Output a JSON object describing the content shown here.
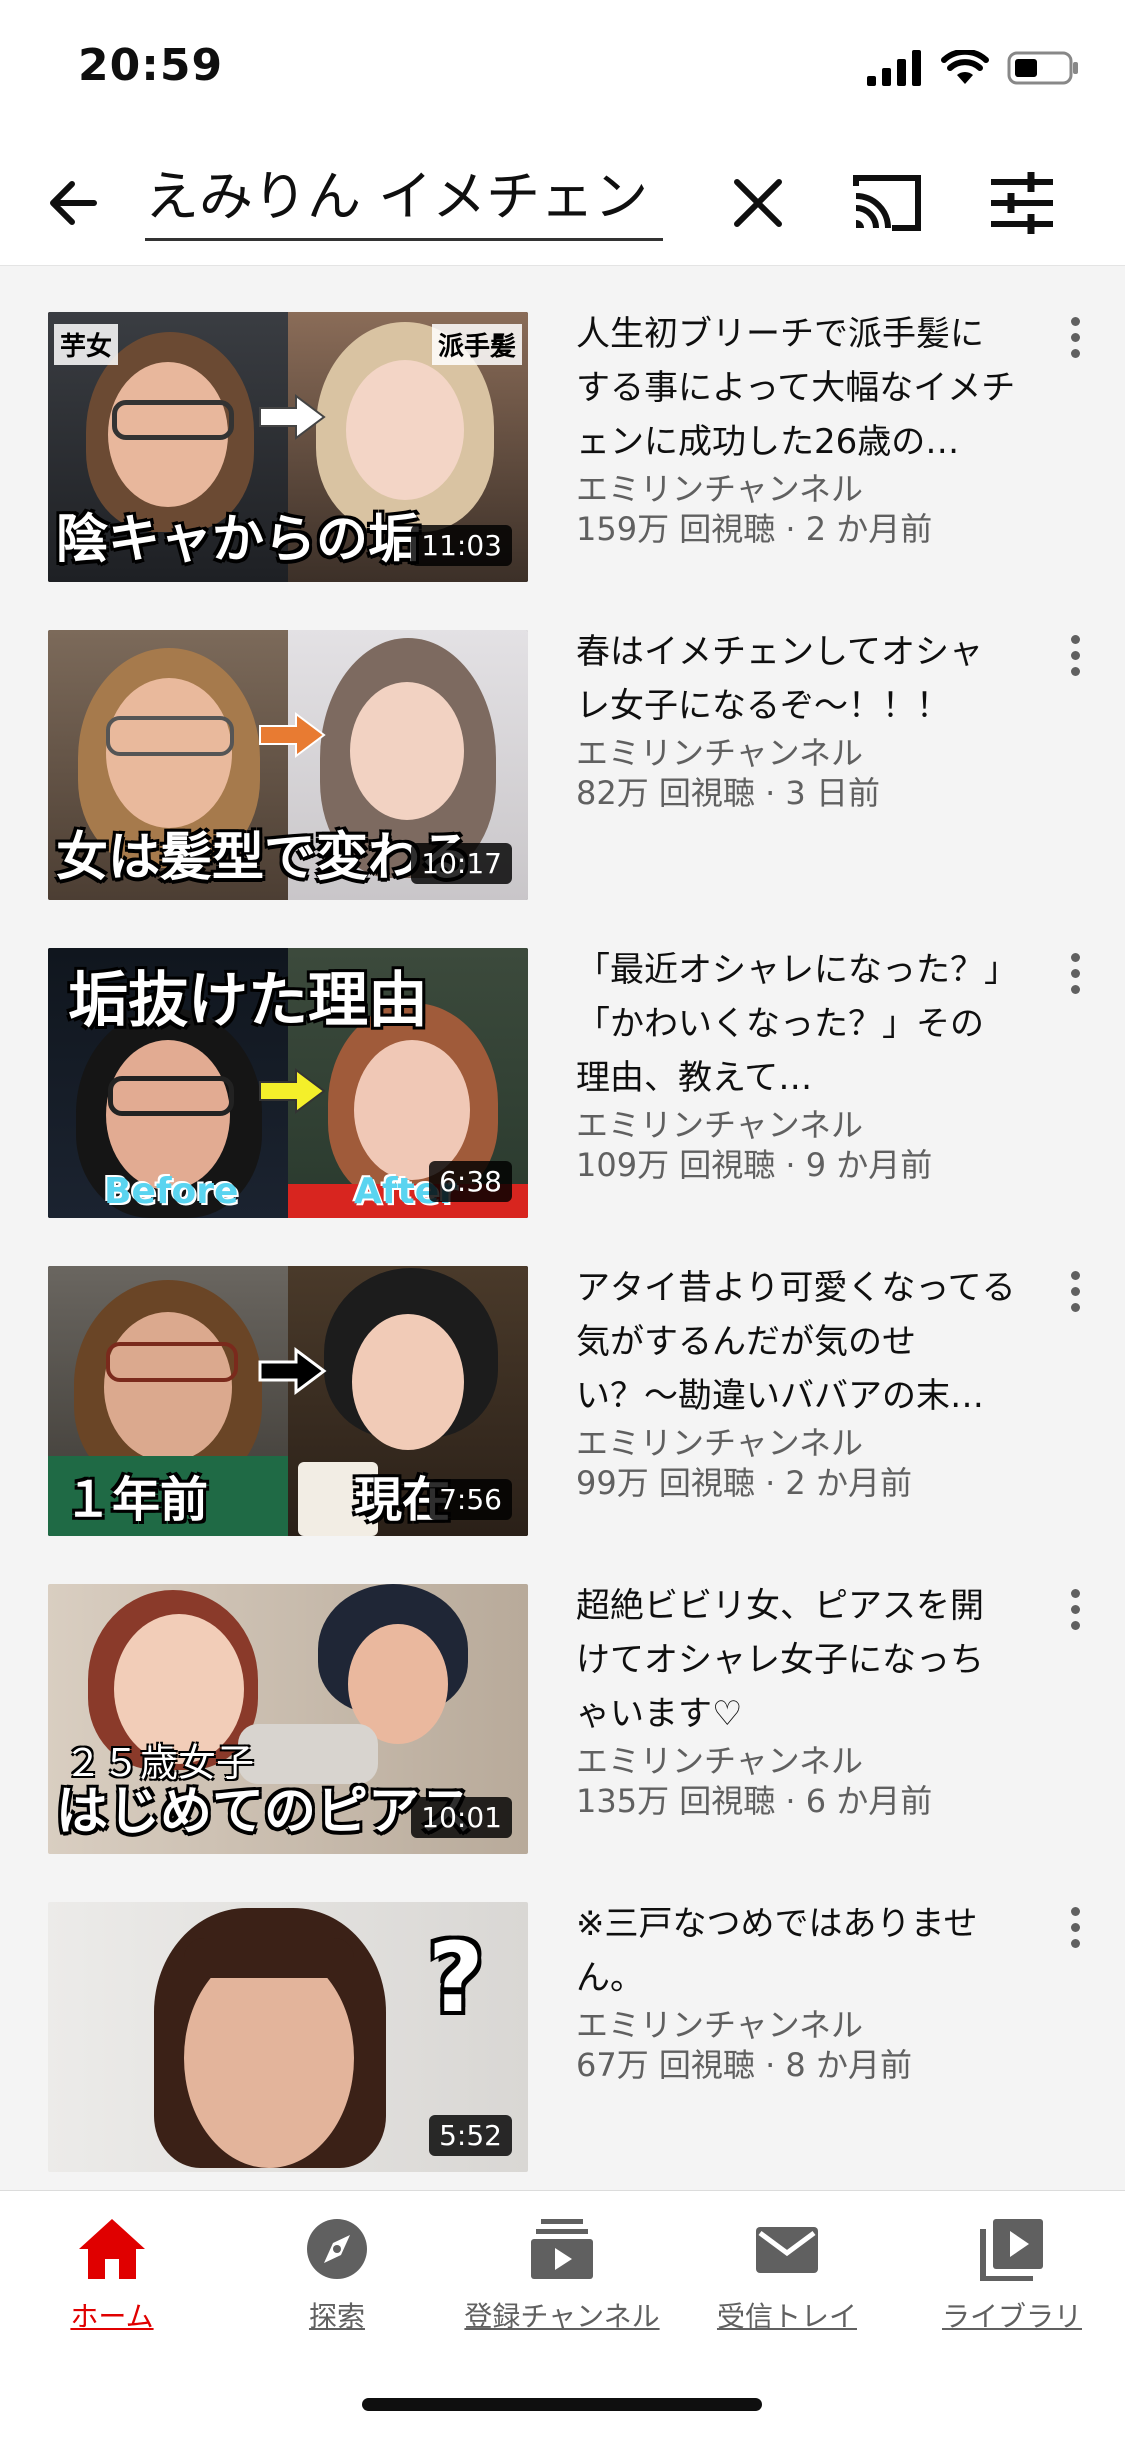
{
  "status_bar": {
    "time": "20:59"
  },
  "search": {
    "query": "えみりん イメチェン"
  },
  "colors": {
    "accent": "#e00000",
    "secondary_text": "#606060"
  },
  "results": [
    {
      "title": "人生初ブリーチで派手髪にする事によって大幅なイメチェンに成功した26歳の…",
      "channel": "エミリンチャンネル",
      "meta": "159万 回視聴 · 2 か月前",
      "duration": "11:03",
      "thumb_caption": "陰キャからの垢",
      "tag_left": "芋女",
      "tag_right": "派手髪"
    },
    {
      "title": "春はイメチェンしてオシャレ女子になるぞ〜！！！",
      "channel": "エミリンチャンネル",
      "meta": "82万 回視聴 · 3 日前",
      "duration": "10:17",
      "thumb_caption": "女は髪型で変わる"
    },
    {
      "title": "「最近オシャレになった？」「かわいくなった？」その理由、教えて…",
      "channel": "エミリンチャンネル",
      "meta": "109万 回視聴 · 9 か月前",
      "duration": "6:38",
      "thumb_top_caption": "垢抜けた理由",
      "label_before": "Before",
      "label_after": "After"
    },
    {
      "title": "アタイ昔より可愛くなってる気がするんだが気のせい？〜勘違いババアの末…",
      "channel": "エミリンチャンネル",
      "meta": "99万 回視聴 · 2 か月前",
      "duration": "7:56",
      "label_before": "１年前",
      "label_after": "現在"
    },
    {
      "title": "超絶ビビリ女、ピアスを開けてオシャレ女子になっちゃいます♡",
      "channel": "エミリンチャンネル",
      "meta": "135万 回視聴 · 6 か月前",
      "duration": "10:01",
      "thumb_small_caption": "２５歳女子",
      "thumb_caption": "はじめてのピアス"
    },
    {
      "title": "※三戸なつめではありません。",
      "channel": "エミリンチャンネル",
      "meta": "67万 回視聴 · 8 か月前",
      "duration": "5:52",
      "thumb_mark": "?"
    }
  ],
  "bottom_nav": [
    {
      "label": "ホーム",
      "icon": "home-icon",
      "active": true
    },
    {
      "label": "探索",
      "icon": "compass-icon",
      "active": false
    },
    {
      "label": "登録チャンネル",
      "icon": "subscriptions-icon",
      "active": false
    },
    {
      "label": "受信トレイ",
      "icon": "inbox-icon",
      "active": false
    },
    {
      "label": "ライブラリ",
      "icon": "library-icon",
      "active": false
    }
  ]
}
